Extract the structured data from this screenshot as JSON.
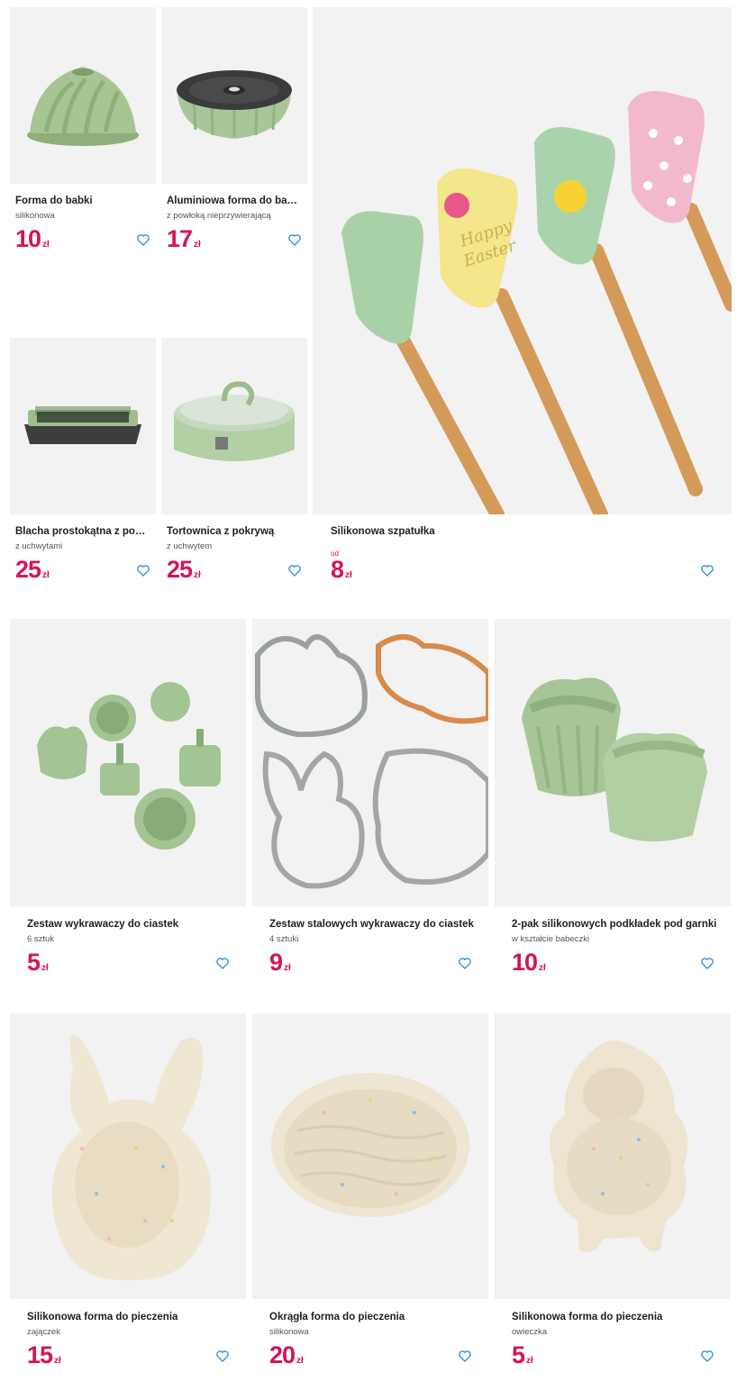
{
  "currency": "zł",
  "colors": {
    "price": "#d4145a",
    "heart": "#2a8fd8",
    "image_bg": "#f2f2f2"
  },
  "products": [
    {
      "id": "bundt-silicone",
      "title": "Forma do babki",
      "subtitle": "silikonowa",
      "price": "10",
      "icon": "heart-icon"
    },
    {
      "id": "bundt-aluminium",
      "title": "Aluminiowa forma do babki",
      "subtitle": "z powłoką nieprzywierającą",
      "price": "17",
      "icon": "heart-icon"
    },
    {
      "id": "rect-pan",
      "title": "Blacha prostokątna z pokr...",
      "subtitle": "z uchwytami",
      "price": "25",
      "icon": "heart-icon"
    },
    {
      "id": "springform",
      "title": "Tortownica z pokrywą",
      "subtitle": "z uchwytem",
      "price": "25",
      "icon": "heart-icon"
    },
    {
      "id": "spatula",
      "title": "Silikonowa szpatułka",
      "price_prefix": "od",
      "price": "8",
      "icon": "heart-icon"
    },
    {
      "id": "cutter-set",
      "title": "Zestaw wykrawaczy do ciastek",
      "subtitle": "6 sztuk",
      "price": "5",
      "icon": "heart-icon"
    },
    {
      "id": "steel-cutters",
      "title": "Zestaw stalowych wykrawaczy do ciastek",
      "subtitle": "4 sztuki",
      "price": "9",
      "icon": "heart-icon"
    },
    {
      "id": "pot-holders",
      "title": "2-pak silikonowych podkładek pod garnki",
      "subtitle": "w kształcie babeczki",
      "price": "10",
      "icon": "heart-icon"
    },
    {
      "id": "bunny-mold",
      "title": "Silikonowa forma do pieczenia",
      "subtitle": "zajączek",
      "price": "15",
      "icon": "heart-icon"
    },
    {
      "id": "round-mold",
      "title": "Okrągła forma do pieczenia",
      "subtitle": "silikonowa",
      "price": "20",
      "icon": "heart-icon"
    },
    {
      "id": "sheep-mold",
      "title": "Silikonowa forma do pieczenia",
      "subtitle": "owieczka",
      "price": "5",
      "icon": "heart-icon"
    }
  ]
}
